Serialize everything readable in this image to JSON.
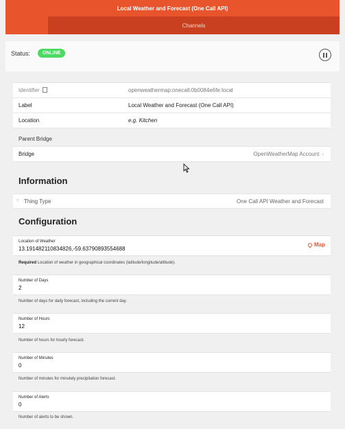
{
  "window": {
    "title": "Local Weather and Forecast (One Call API)"
  },
  "tabs": [
    {
      "label": "Channels"
    }
  ],
  "status": {
    "label": "Status:",
    "badge": "ONLINE"
  },
  "info_rows": {
    "identifier": {
      "label": "Identifier",
      "value": "openweathermap:onecall:0b0084e6fe:local"
    },
    "label": {
      "label": "Label",
      "value": "Local Weather and Forecast (One Call API)"
    },
    "location": {
      "label": "Location",
      "placeholder": "e.g. Kitchen"
    }
  },
  "parent_bridge": {
    "heading": "Parent Bridge",
    "label": "Bridge",
    "value": "OpenWeatherMap Account"
  },
  "information": {
    "heading": "Information",
    "thing_type_label": "Thing Type",
    "thing_type_value": "One Call API Weather and Forecast"
  },
  "configuration": {
    "heading": "Configuration",
    "location": {
      "label": "Location of Weather",
      "value": "13.191482110834826,-59.63790893554688",
      "map_label": "Map",
      "required": "Required",
      "description": "Location of weather in geographical coordinates (latitude/longitude/altitude)."
    },
    "days": {
      "label": "Number of Days",
      "value": "2",
      "description": "Number of days for daily forecast, including the current day."
    },
    "hours": {
      "label": "Number of Hours",
      "value": "12",
      "description": "Number of hours for hourly forecast."
    },
    "minutes": {
      "label": "Number of Minutes",
      "value": "0",
      "description": "Number of minutes for minutely precipitation forecast."
    },
    "alerts": {
      "label": "Number of Alerts",
      "value": "0",
      "description": "Number of alerts to be shown."
    }
  },
  "colors": {
    "accent": "#e8542b",
    "tab_active": "#c8401f",
    "online": "#4cd964"
  },
  "icons": [
    "copy-icon",
    "pause-icon",
    "chevron-right-icon",
    "triangle-icon",
    "map-pin-icon",
    "cursor-icon"
  ]
}
